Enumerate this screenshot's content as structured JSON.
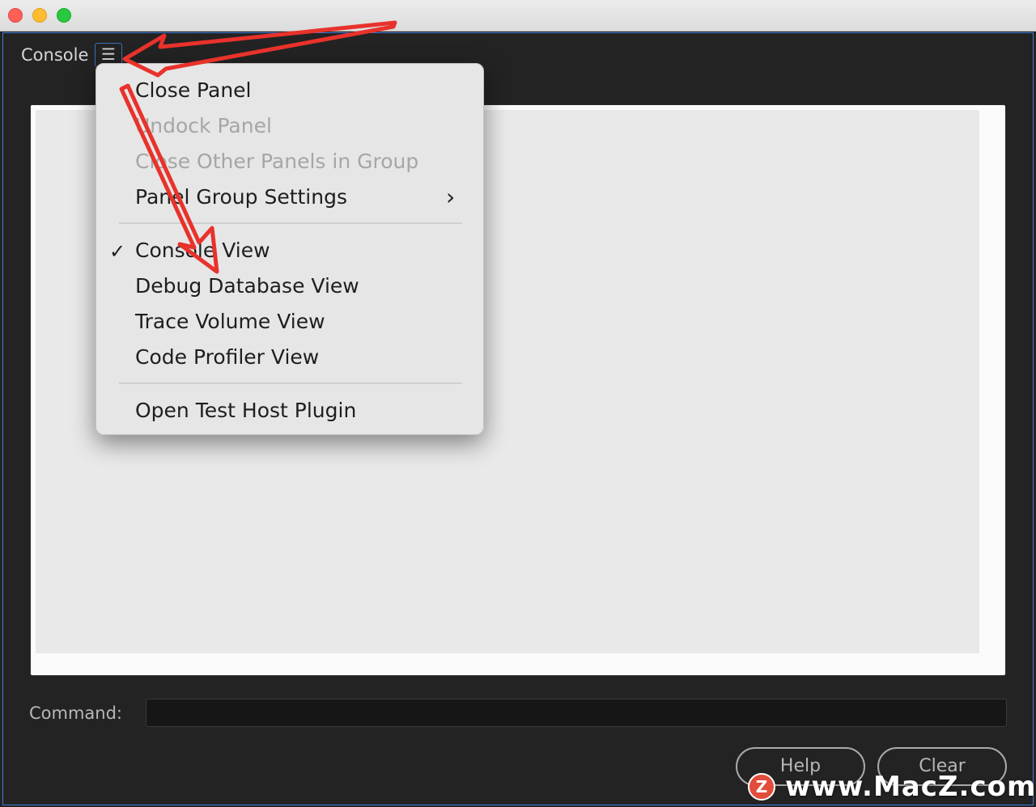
{
  "panel": {
    "title": "Console",
    "menu_icon": "hamburger-icon"
  },
  "menu": {
    "items": [
      {
        "label": "Close Panel",
        "enabled": true
      },
      {
        "label": "Undock Panel",
        "enabled": false
      },
      {
        "label": "Close Other Panels in Group",
        "enabled": false
      },
      {
        "label": "Panel Group Settings",
        "enabled": true,
        "submenu": true
      },
      {
        "label": "Console View",
        "enabled": true,
        "checked": true
      },
      {
        "label": "Debug Database View",
        "enabled": true
      },
      {
        "label": "Trace Volume View",
        "enabled": true
      },
      {
        "label": "Code Profiler View",
        "enabled": true
      },
      {
        "label": "Open Test Host Plugin",
        "enabled": true
      }
    ],
    "check_glyph": "✓",
    "submenu_glyph": "›"
  },
  "command": {
    "label": "Command:",
    "value": ""
  },
  "buttons": {
    "help": "Help",
    "clear": "Clear"
  },
  "watermark": {
    "logo": "Z",
    "text": "www.MacZ.com"
  },
  "colors": {
    "annotation_arrow": "#e8322b",
    "focus_border": "#3d7bd6"
  }
}
